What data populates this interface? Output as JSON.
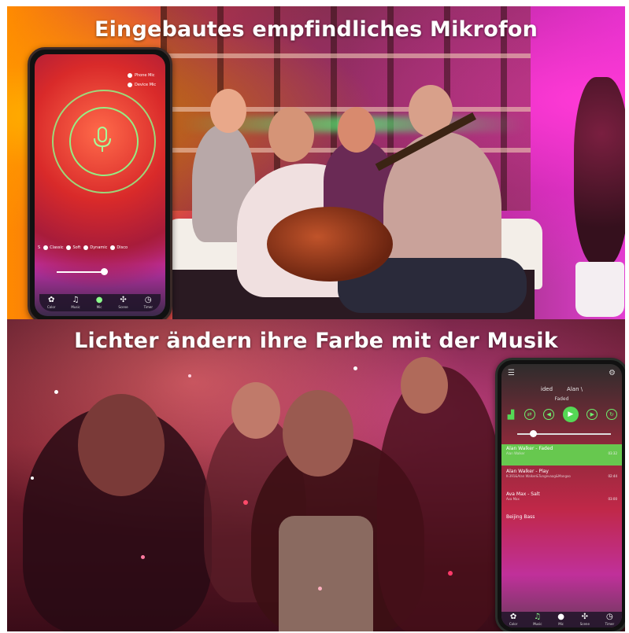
{
  "top_panel": {
    "headline": "Eingebautes empfindliches Mikrofon",
    "phone": {
      "icon": "microphone-icon",
      "options": [
        "Phone Mic",
        "Device Mic"
      ],
      "modes": [
        "S",
        "Classic",
        "Soft",
        "Dynamic",
        "Disco"
      ],
      "tabs": [
        {
          "label": "Color",
          "icon": "palette-icon"
        },
        {
          "label": "Music",
          "icon": "music-note-icon"
        },
        {
          "label": "Mic",
          "icon": "microphone-icon"
        },
        {
          "label": "Scene",
          "icon": "scene-icon"
        },
        {
          "label": "Timer",
          "icon": "clock-icon"
        }
      ]
    }
  },
  "bottom_panel": {
    "headline": "Lichter ändern ihre Farbe mit der Musik",
    "phone": {
      "tabs_top": [
        "ided",
        "Alan \\"
      ],
      "now_playing": "Faded",
      "tracks": [
        {
          "title": "Alan Walker - Faded",
          "subtitle": "Alan Walker",
          "time": "03:32",
          "active": true
        },
        {
          "title": "Alan Walker - Play",
          "subtitle": "K-391&Alan Walker&Tungevaag&Mangoo",
          "time": "02:44",
          "active": false
        },
        {
          "title": "Ava Max - Salt",
          "subtitle": "Ava Max",
          "time": "03:00",
          "active": false
        },
        {
          "title": "Beijing Bass",
          "subtitle": "",
          "time": "",
          "active": false
        }
      ],
      "tabs": [
        {
          "label": "Color",
          "icon": "palette-icon"
        },
        {
          "label": "Music",
          "icon": "music-note-icon"
        },
        {
          "label": "Mic",
          "icon": "microphone-icon"
        },
        {
          "label": "Scene",
          "icon": "scene-icon"
        },
        {
          "label": "Timer",
          "icon": "clock-icon"
        }
      ]
    }
  },
  "colors": {
    "accent_green": "#67c84f",
    "ring_green": "#8cff8c"
  }
}
